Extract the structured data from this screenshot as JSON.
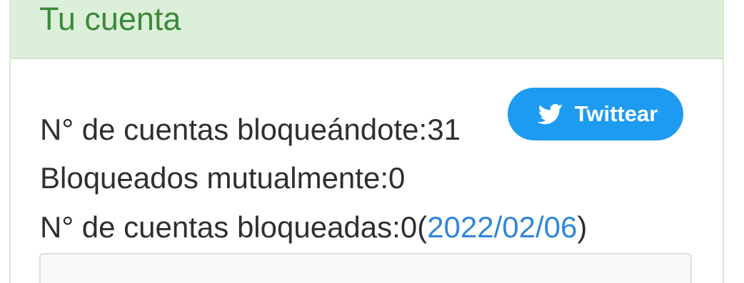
{
  "account_panel": {
    "title": "Tu cuenta"
  },
  "stats": {
    "blocking_you_label": "N° de cuentas bloqueándote:",
    "blocking_you_count": "31",
    "mutual_blocked_label": "Bloqueados mutualmente:",
    "mutual_blocked_count": "0",
    "blocked_accounts_label": "N° de cuentas bloqueadas:",
    "blocked_accounts_count": "0",
    "blocked_accounts_open_paren": "(",
    "blocked_accounts_date": "2022/02/06",
    "blocked_accounts_close_paren": ")"
  },
  "actions": {
    "tweet_label": "Twittear",
    "tweet_icon": "twitter-bird-icon"
  },
  "colors": {
    "panel_heading_bg": "#dcefd9",
    "panel_title_text": "#3b8a3a",
    "tweet_button_bg": "#1d9bf0",
    "date_link": "#2f86d8"
  }
}
